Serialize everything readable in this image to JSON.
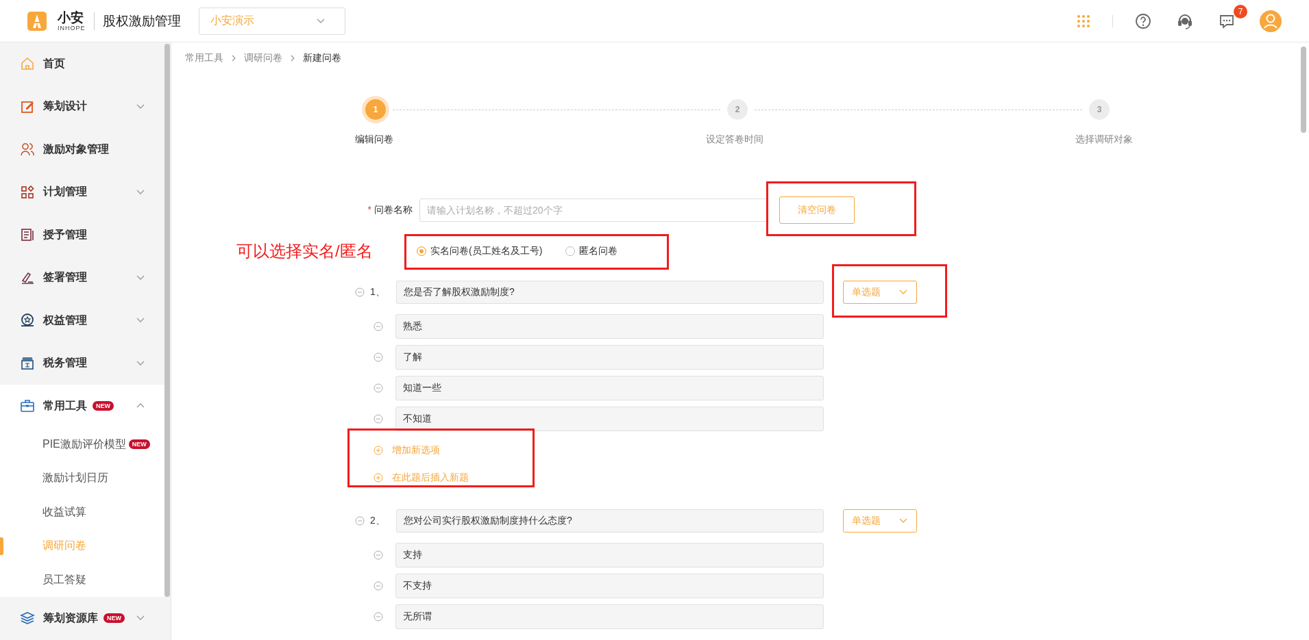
{
  "header": {
    "logo": {
      "name": "小安",
      "sub": "INHOPE"
    },
    "app_title": "股权激励管理",
    "company_select": {
      "value": "小安演示"
    },
    "message_badge": "7"
  },
  "sidebar": {
    "items": [
      {
        "label": "首页",
        "expandable": false
      },
      {
        "label": "筹划设计",
        "expandable": true,
        "expanded": false
      },
      {
        "label": "激励对象管理",
        "expandable": false
      },
      {
        "label": "计划管理",
        "expandable": true,
        "expanded": false
      },
      {
        "label": "授予管理",
        "expandable": false
      },
      {
        "label": "签署管理",
        "expandable": true,
        "expanded": false
      },
      {
        "label": "权益管理",
        "expandable": true,
        "expanded": false
      },
      {
        "label": "税务管理",
        "expandable": true,
        "expanded": false
      },
      {
        "label": "常用工具",
        "badge": "NEW",
        "expandable": true,
        "expanded": true,
        "children": [
          {
            "label": "PIE激励评价模型",
            "badge": "NEW",
            "selected": false
          },
          {
            "label": "激励计划日历",
            "selected": false
          },
          {
            "label": "收益试算",
            "selected": false
          },
          {
            "label": "调研问卷",
            "selected": true
          },
          {
            "label": "员工答疑",
            "selected": false
          }
        ]
      },
      {
        "label": "筹划资源库",
        "badge": "NEW",
        "expandable": true,
        "expanded": false
      }
    ]
  },
  "breadcrumb": [
    "常用工具",
    "调研问卷",
    "新建问卷"
  ],
  "steps": [
    {
      "number": "1",
      "label": "编辑问卷",
      "selected": true
    },
    {
      "number": "2",
      "label": "设定答卷时间",
      "selected": false
    },
    {
      "number": "3",
      "label": "选择调研对象",
      "selected": false
    }
  ],
  "form": {
    "name_field": {
      "label": "问卷名称",
      "required_mark": "*",
      "placeholder": "请输入计划名称，不超过20个字"
    },
    "clear_button": "清空问卷",
    "annotation": "可以选择实名/匿名",
    "identity_options": [
      {
        "label": "实名问卷(员工姓名及工号)",
        "selected": true
      },
      {
        "label": "匿名问卷",
        "selected": false
      }
    ],
    "questions": [
      {
        "number": "1、",
        "title": "您是否了解股权激励制度?",
        "type": "单选题",
        "options": [
          "熟悉",
          "了解",
          "知道一些",
          "不知道"
        ],
        "actions": [
          "增加新选项",
          "在此题后插入新题"
        ]
      },
      {
        "number": "2、",
        "title": "您对公司实行股权激励制度持什么态度?",
        "type": "单选题",
        "options": [
          "支持",
          "不支持",
          "无所谓"
        ]
      }
    ]
  }
}
